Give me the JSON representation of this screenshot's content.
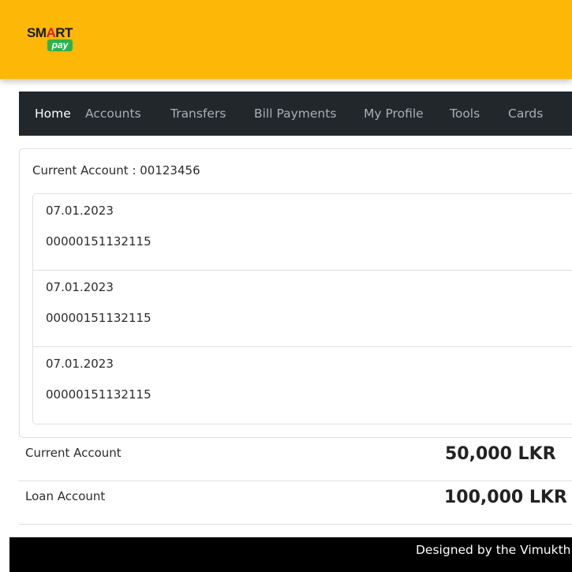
{
  "brand": {
    "logo_smart_prefix": "SM",
    "logo_smart_accent": "A",
    "logo_smart_suffix": "RT",
    "logo_pay": "pay"
  },
  "nav": {
    "items": [
      "Home",
      "Accounts",
      "Transfers",
      "Bill Payments",
      "My Profile",
      "Tools",
      "Cards"
    ],
    "active": "Home"
  },
  "account_card": {
    "label": "Current Account : 00123456",
    "transactions": [
      {
        "date": "07.01.2023",
        "reference": "00000151132115"
      },
      {
        "date": "07.01.2023",
        "reference": "00000151132115"
      },
      {
        "date": "07.01.2023",
        "reference": "00000151132115"
      }
    ]
  },
  "balances": [
    {
      "label": "Current Account",
      "value": "50,000 LKR"
    },
    {
      "label": "Loan Account",
      "value": "100,000 LKR"
    }
  ],
  "footer": {
    "text": "Designed by the Vimukth"
  },
  "colors": {
    "header_bg": "#fdb706",
    "nav_bg": "#22272c",
    "logo_accent_red": "#d6202a",
    "logo_pay_green": "#2bb24c",
    "footer_bg": "#000000"
  }
}
